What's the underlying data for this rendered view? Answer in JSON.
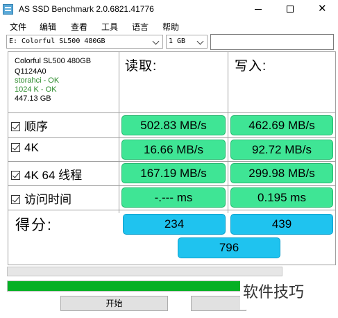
{
  "window": {
    "title": "AS SSD Benchmark 2.0.6821.41776",
    "controls": {
      "minimize": "",
      "maximize": "",
      "close": "✕"
    }
  },
  "menu": [
    "文件",
    "编辑",
    "查看",
    "工具",
    "语言",
    "帮助"
  ],
  "toolbar": {
    "drive_select": "E: Colorful SL500 480GB",
    "size_select": "1 GB",
    "path_input": ""
  },
  "drive_info": {
    "name": "Colorful SL500 480GB",
    "firmware": "Q1124A0",
    "driver": "storahci - OK",
    "alignment": "1024 K - OK",
    "capacity": "447.13 GB"
  },
  "columns": {
    "read": "读取:",
    "write": "写入:"
  },
  "tests": [
    {
      "name": "顺序",
      "read": "502.83 MB/s",
      "write": "462.69 MB/s"
    },
    {
      "name": "4K",
      "read": "16.66 MB/s",
      "write": "92.72 MB/s"
    },
    {
      "name": "4K 64 线程",
      "read": "167.19 MB/s",
      "write": "299.98 MB/s"
    },
    {
      "name": "访问时间",
      "read": "-.--- ms",
      "write": "0.195 ms"
    }
  ],
  "score": {
    "label": "得分:",
    "read": "234",
    "write": "439",
    "total": "796"
  },
  "progress": {
    "overall_fraction": 1.0
  },
  "buttons": {
    "start": "开始",
    "abort": ""
  },
  "watermark": "软件技巧",
  "colors": {
    "result_green": "#3fe595",
    "score_blue": "#1fc3ef",
    "progress_green": "#06b025"
  }
}
